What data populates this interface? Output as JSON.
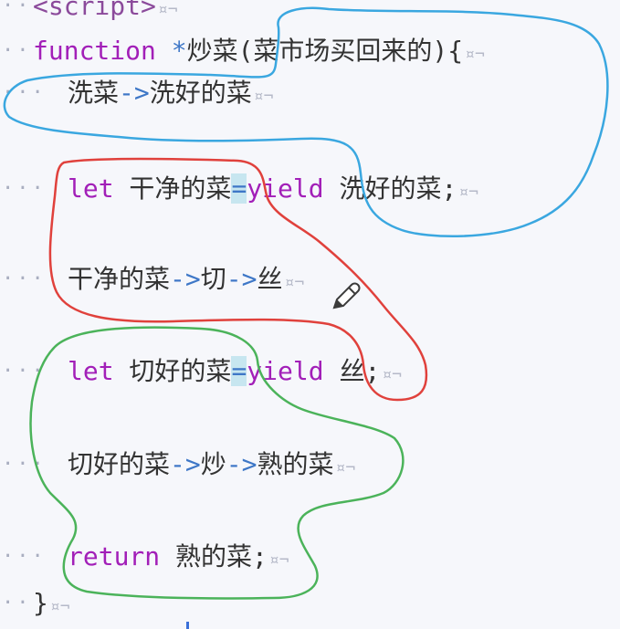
{
  "lines": [
    {
      "gutter": "··",
      "parts": [
        {
          "t": "<script>",
          "c": "tag"
        },
        {
          "t": "¤¬",
          "c": "mark"
        }
      ]
    },
    {
      "gutter": "··",
      "parts": [
        {
          "t": "function",
          "c": "kw"
        },
        {
          "t": " ",
          "c": "txt"
        },
        {
          "t": "*",
          "c": "op"
        },
        {
          "t": "炒菜(菜市场买回来的){",
          "c": "txt"
        },
        {
          "t": "¤¬",
          "c": "mark"
        }
      ]
    },
    {
      "gutter": "···",
      "parts": [
        {
          "t": "洗菜",
          "c": "txt"
        },
        {
          "t": "->",
          "c": "arrow"
        },
        {
          "t": "洗好的菜",
          "c": "txt"
        },
        {
          "t": "¤¬",
          "c": "mark"
        }
      ]
    },
    {
      "gutter": "",
      "parts": []
    },
    {
      "gutter": "···",
      "parts": [
        {
          "t": "let",
          "c": "kw"
        },
        {
          "t": " 干净的菜",
          "c": "txt"
        },
        {
          "t": "=",
          "c": "op"
        },
        {
          "t": "yield",
          "c": "kw2"
        },
        {
          "t": " 洗好的菜;",
          "c": "txt"
        },
        {
          "t": "¤¬",
          "c": "mark"
        }
      ]
    },
    {
      "gutter": "",
      "parts": []
    },
    {
      "gutter": "···",
      "parts": [
        {
          "t": "干净的菜",
          "c": "txt"
        },
        {
          "t": "->",
          "c": "arrow"
        },
        {
          "t": "切",
          "c": "txt"
        },
        {
          "t": "->",
          "c": "arrow"
        },
        {
          "t": "丝",
          "c": "txt"
        },
        {
          "t": "¤¬",
          "c": "mark"
        }
      ]
    },
    {
      "gutter": "",
      "parts": []
    },
    {
      "gutter": "···",
      "parts": [
        {
          "t": "let",
          "c": "kw"
        },
        {
          "t": " 切好的菜",
          "c": "txt"
        },
        {
          "t": "=",
          "c": "op"
        },
        {
          "t": "yield",
          "c": "kw2"
        },
        {
          "t": " 丝;",
          "c": "txt"
        },
        {
          "t": "¤¬",
          "c": "mark"
        }
      ]
    },
    {
      "gutter": "",
      "parts": []
    },
    {
      "gutter": "···",
      "parts": [
        {
          "t": "切好的菜",
          "c": "txt"
        },
        {
          "t": "->",
          "c": "arrow"
        },
        {
          "t": "炒",
          "c": "txt"
        },
        {
          "t": "->",
          "c": "arrow"
        },
        {
          "t": "熟的菜",
          "c": "txt"
        },
        {
          "t": "¤¬",
          "c": "mark"
        }
      ]
    },
    {
      "gutter": "",
      "parts": []
    },
    {
      "gutter": "···",
      "parts": [
        {
          "t": "return",
          "c": "kw"
        },
        {
          "t": " 熟的菜;",
          "c": "txt"
        },
        {
          "t": "¤¬",
          "c": "mark"
        }
      ]
    },
    {
      "gutter": "··",
      "parts": [
        {
          "t": "}",
          "c": "txt"
        },
        {
          "t": "¤¬",
          "c": "mark"
        }
      ]
    }
  ],
  "colors": {
    "blue_annotation": "#3aa7e0",
    "red_annotation": "#e0413c",
    "green_annotation": "#4bb35a",
    "keyword": "#a21fb8",
    "operator": "#3e77c7"
  },
  "icons": {
    "pencil": "pencil-icon"
  }
}
